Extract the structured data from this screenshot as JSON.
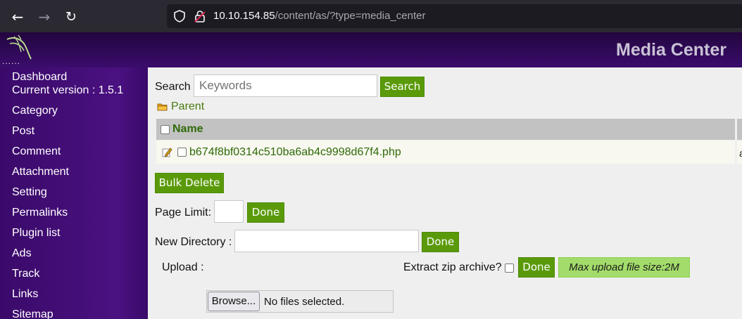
{
  "browser": {
    "url_host": "10.10.154.85",
    "url_path": "/content/as/?type=media_center"
  },
  "header": {
    "logo_dots": "......",
    "title": "Media Center"
  },
  "sidebar": {
    "items": [
      {
        "label": "Dashboard"
      },
      {
        "label": "Category"
      },
      {
        "label": "Post"
      },
      {
        "label": "Comment"
      },
      {
        "label": "Attachment"
      },
      {
        "label": "Setting"
      },
      {
        "label": "Permalinks"
      },
      {
        "label": "Plugin list"
      },
      {
        "label": "Ads"
      },
      {
        "label": "Track"
      },
      {
        "label": "Links"
      },
      {
        "label": "Sitemap"
      }
    ],
    "version_text": "Current version : 1.5.1"
  },
  "main": {
    "search": {
      "label": "Search",
      "placeholder": "Keywords",
      "button": "Search"
    },
    "parent_link": "Parent",
    "table": {
      "column_name": "Name",
      "rows": [
        {
          "name": "b674f8bf0314c510ba6ab4c9998d67f4.php",
          "tail": "a"
        }
      ]
    },
    "bulk_delete": "Bulk Delete",
    "page_limit": {
      "label": "Page Limit:",
      "value": "",
      "button": "Done"
    },
    "new_directory": {
      "label": "New Directory :",
      "value": "",
      "button": "Done"
    },
    "upload": {
      "label": "Upload :",
      "browse": "Browse...",
      "status": "No files selected.",
      "extract_label": "Extract zip archive?",
      "button": "Done",
      "max_size": "Max upload file size:2M"
    }
  },
  "colors": {
    "sidebar_bg": "#3b0a6b",
    "accent_green": "#5a9a0a",
    "link_green": "#2f6a08",
    "notice_green": "#a3dc6a"
  }
}
